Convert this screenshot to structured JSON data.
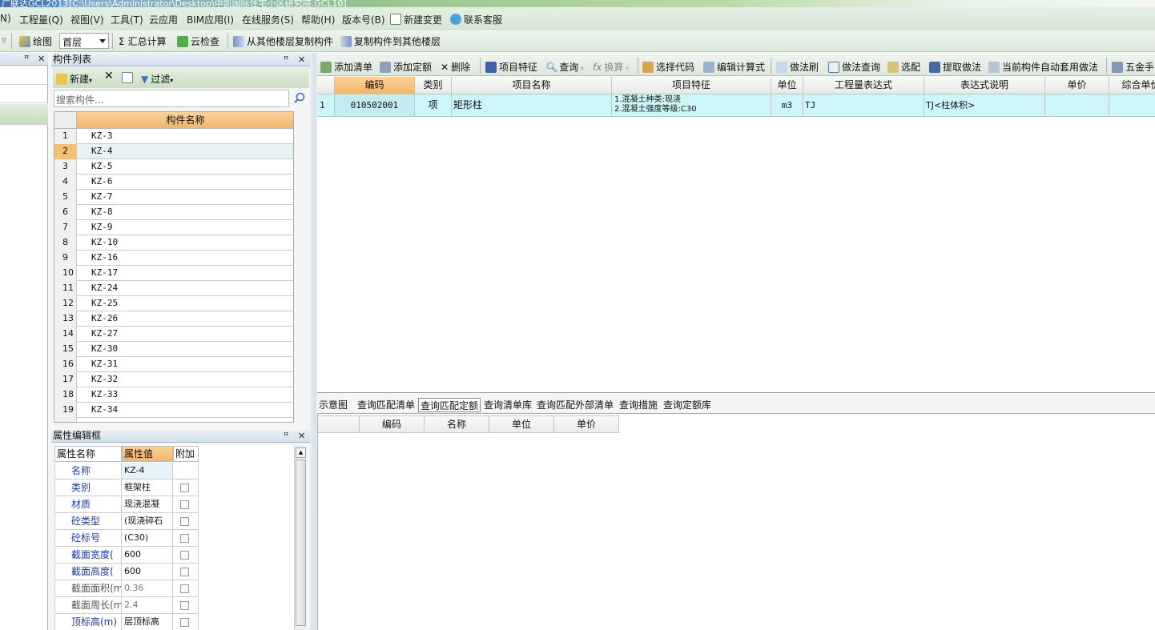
{
  "titlebar": {
    "app": "广联达GCL2013",
    "path": "[C:\\Users\\Administrator\\Desktop\\中凯国际住宅小区研究院.GCL10]"
  },
  "menubar": {
    "items": [
      "N)",
      "工程量(Q)",
      "视图(V)",
      "工具(T)",
      "云应用",
      "BIM应用(I)",
      "在线服务(S)",
      "帮助(H)",
      "版本号(B)",
      "新建变更",
      "联系客服"
    ]
  },
  "toolbar1": {
    "draw_label": "绘图",
    "floor_value": "首层",
    "sum_label": "汇总计算",
    "cloud_check_label": "云检查",
    "copy_from_label": "从其他楼层复制构件",
    "copy_to_label": "复制构件到其他楼层"
  },
  "component_list": {
    "title": "构件列表",
    "new_label": "新建",
    "filter_label": "过滤",
    "search_placeholder": "搜索构件...",
    "column_header": "构件名称",
    "rows": [
      {
        "n": "1",
        "name": "KZ-3"
      },
      {
        "n": "2",
        "name": "KZ-4"
      },
      {
        "n": "3",
        "name": "KZ-5"
      },
      {
        "n": "4",
        "name": "KZ-6"
      },
      {
        "n": "5",
        "name": "KZ-7"
      },
      {
        "n": "6",
        "name": "KZ-8"
      },
      {
        "n": "7",
        "name": "KZ-9"
      },
      {
        "n": "8",
        "name": "KZ-10"
      },
      {
        "n": "9",
        "name": "KZ-16"
      },
      {
        "n": "10",
        "name": "KZ-17"
      },
      {
        "n": "11",
        "name": "KZ-24"
      },
      {
        "n": "12",
        "name": "KZ-25"
      },
      {
        "n": "13",
        "name": "KZ-26"
      },
      {
        "n": "14",
        "name": "KZ-27"
      },
      {
        "n": "15",
        "name": "KZ-30"
      },
      {
        "n": "16",
        "name": "KZ-31"
      },
      {
        "n": "17",
        "name": "KZ-32"
      },
      {
        "n": "18",
        "name": "KZ-33"
      },
      {
        "n": "19",
        "name": "KZ-34"
      }
    ],
    "selected_index": 1
  },
  "property_panel": {
    "title": "属性编辑框",
    "headers": [
      "属性名称",
      "属性值",
      "附加"
    ],
    "rows": [
      {
        "name": "名称",
        "value": "KZ-4",
        "gray": false
      },
      {
        "name": "类别",
        "value": "框架柱",
        "gray": false
      },
      {
        "name": "材质",
        "value": "现浇混凝",
        "gray": false
      },
      {
        "name": "砼类型",
        "value": "(现浇碎石",
        "gray": false
      },
      {
        "name": "砼标号",
        "value": "(C30)",
        "gray": false
      },
      {
        "name": "截面宽度(",
        "value": "600",
        "gray": false
      },
      {
        "name": "截面高度(",
        "value": "600",
        "gray": false
      },
      {
        "name": "截面面积(m",
        "value": "0.36",
        "gray": true
      },
      {
        "name": "截面周长(m",
        "value": "2.4",
        "gray": true
      },
      {
        "name": "顶标高(m)",
        "value": "层顶标高",
        "gray": false
      }
    ]
  },
  "rt_toolbar": {
    "items": [
      "添加清单",
      "添加定额",
      "删除",
      "项目特征",
      "查询",
      "换算",
      "选择代码",
      "编辑计算式",
      "做法刷",
      "做法查询",
      "选配",
      "提取做法",
      "当前构件自动套用做法",
      "五金手"
    ]
  },
  "rt_table": {
    "headers": [
      "编码",
      "类别",
      "项目名称",
      "项目特征",
      "单位",
      "工程量表达式",
      "表达式说明",
      "单价",
      "综合单价"
    ],
    "rows": [
      {
        "n": "1",
        "code": "010502001",
        "type": "项",
        "name": "矩形柱",
        "feature1": "1.混凝土种类:现浇",
        "feature2": "2.混凝土强度等级:C30",
        "unit": "m3",
        "expr": "TJ",
        "desc": "TJ<柱体积>",
        "price": "",
        "total": ""
      }
    ]
  },
  "rb_tabs": {
    "items": [
      "示意图",
      "查询匹配清单",
      "查询匹配定额",
      "查询清单库",
      "查询匹配外部清单",
      "查询措施",
      "查询定额库"
    ],
    "active_index": 2
  },
  "rb_grid": {
    "headers": [
      "编码",
      "名称",
      "单位",
      "单价"
    ]
  },
  "colors": {
    "accent_orange": "#f4b56a",
    "selected_row": "#cdf6f8",
    "label_blue": "#1a3aa8"
  }
}
